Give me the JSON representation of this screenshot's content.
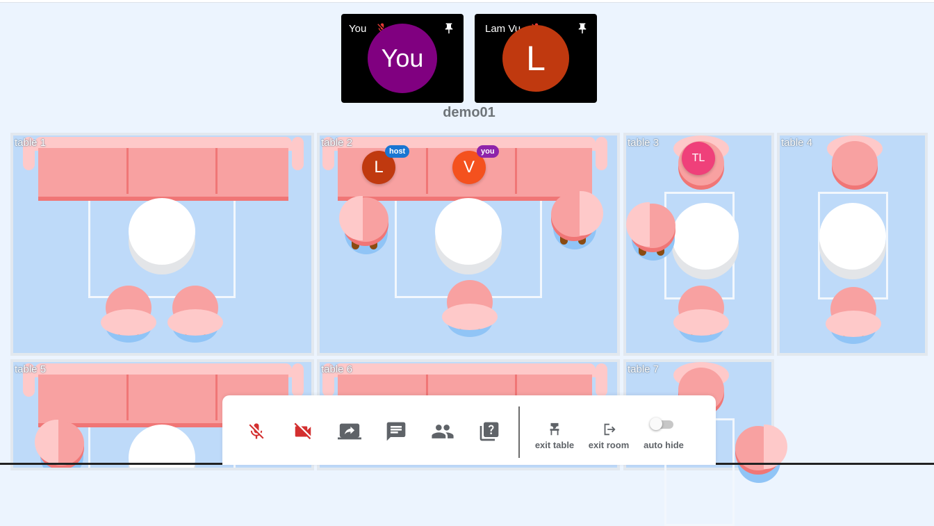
{
  "video_tiles": [
    {
      "name": "You",
      "avatar_text": "You",
      "avatar_color": "#800080",
      "muted": true,
      "pinned": true
    },
    {
      "name": "Lam Vu",
      "avatar_text": "L",
      "avatar_color": "#c0390f",
      "muted": true,
      "pinned": true
    }
  ],
  "room": {
    "name": "demo01"
  },
  "tables": [
    {
      "label": "table 1"
    },
    {
      "label": "table 2"
    },
    {
      "label": "table 3"
    },
    {
      "label": "table 4"
    },
    {
      "label": "table 5"
    },
    {
      "label": "table 6"
    },
    {
      "label": "table 7"
    }
  ],
  "seated_users": [
    {
      "initials": "L",
      "badge": "host",
      "avatar_color": "#c0390f",
      "badge_color": "#1976d2",
      "table": "table 2"
    },
    {
      "initials": "V",
      "badge": "you",
      "avatar_color": "#f4511e",
      "badge_color": "#8e24aa",
      "table": "table 2"
    },
    {
      "initials": "TL",
      "avatar_color": "#ef407a",
      "table": "table 3"
    }
  ],
  "toolbar": {
    "buttons": [
      {
        "icon": "mic-off-icon",
        "color": "#d32f2f"
      },
      {
        "icon": "videocam-off-icon",
        "color": "#d32f2f"
      },
      {
        "icon": "screen-share-icon",
        "color": "#5f6368"
      },
      {
        "icon": "chat-icon",
        "color": "#5f6368"
      },
      {
        "icon": "people-icon",
        "color": "#5f6368"
      },
      {
        "icon": "help-icon",
        "color": "#5f6368"
      }
    ],
    "exit_table_label": "exit table",
    "exit_room_label": "exit room",
    "auto_hide_label": "auto hide",
    "auto_hide_on": false
  }
}
